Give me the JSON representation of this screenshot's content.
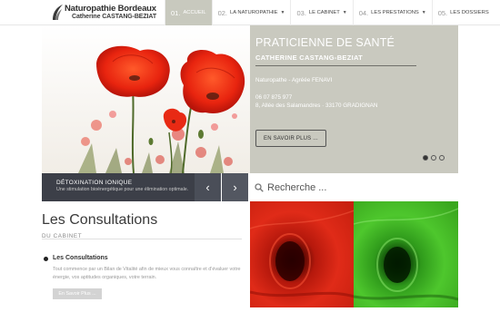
{
  "header": {
    "logo_line1": "Naturopathie Bordeaux",
    "logo_line2": "Catherine CASTANG-BEZIAT",
    "nav": [
      {
        "num": "01.",
        "label": "ACCUEIL",
        "active": true,
        "dropdown": false
      },
      {
        "num": "02.",
        "label": "LA NATUROPATHIE",
        "active": false,
        "dropdown": true
      },
      {
        "num": "03.",
        "label": "LE CABINET",
        "active": false,
        "dropdown": true
      },
      {
        "num": "04.",
        "label": "LES PRESTATIONS",
        "active": false,
        "dropdown": true
      },
      {
        "num": "05.",
        "label": "LES DOSSIERS",
        "active": false,
        "dropdown": false
      }
    ]
  },
  "hero": {
    "title": "PRATICIENNE DE SANTÉ",
    "subtitle": "CATHERINE CASTANG-BEZIAT",
    "line1": "Naturopathe - Agréée FENAVI",
    "phone": "06 07 875 977",
    "address": "8, Allée des Salamandres · 33170 GRADIGNAN",
    "button": "EN SAVOIR PLUS ...",
    "slides": 3,
    "active_slide": 1
  },
  "caption": {
    "title": "DÉTOXINATION IONIQUE",
    "text": "Une stimulation bioénergétique pour une élimination optimale.",
    "prev": "‹",
    "next": "›"
  },
  "search": {
    "placeholder": "Recherche ..."
  },
  "consultations": {
    "title": "Les Consultations",
    "subtitle": "DU CABINET",
    "item_title": "Les Consultations",
    "item_text": "Tout commence par un Bilan de Vitalité afin de mieux vous connaître et d'évaluer votre énergie, vos aptitudes organiques, votre terrain.",
    "item_button": "En Savoir Plus ..."
  },
  "colors": {
    "hero_bg": "#c9c9bf",
    "nav_active": "#c8c9be",
    "caption_bg": "#3c3f48",
    "panel_red": "#d9261c",
    "panel_green": "#3cb521"
  }
}
